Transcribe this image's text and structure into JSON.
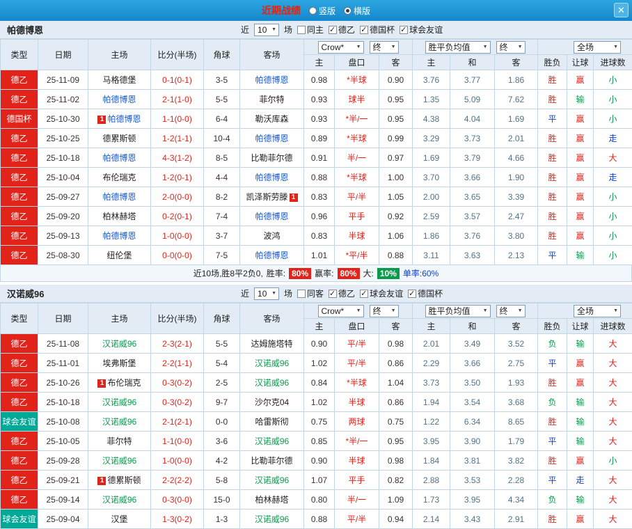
{
  "topbar": {
    "title": "近期战绩",
    "radios": [
      {
        "label": "竖版",
        "selected": false
      },
      {
        "label": "横版",
        "selected": true
      }
    ],
    "close": "✕"
  },
  "result_colors": {
    "胜": "#e2231a",
    "赢": "#e2231a",
    "大": "#e2231a",
    "平": "#1040d0",
    "走": "#1040d0",
    "负": "#089b4c",
    "输": "#089b4c",
    "小": "#089b4c"
  },
  "league_colors": {
    "德乙": "#e2231a",
    "德国杯": "#e2231a",
    "球会友谊": "#00a896"
  },
  "sections": [
    {
      "team": "帕德博恩",
      "highlight": "#1659d0",
      "filters": {
        "near": "近",
        "count": "10",
        "unit": "场",
        "checks": [
          {
            "label": "同主",
            "checked": false
          },
          {
            "label": "德乙",
            "checked": true
          },
          {
            "label": "德国杯",
            "checked": true
          },
          {
            "label": "球会友谊",
            "checked": true
          }
        ]
      },
      "selects": {
        "company": "Crow*",
        "final": "终",
        "average": "胜平负均值",
        "final2": "终",
        "scope": "全场"
      },
      "columns": {
        "type": "类型",
        "date": "日期",
        "home": "主场",
        "score": "比分(半场)",
        "corner": "角球",
        "away": "客场",
        "sub": [
          "主",
          "盘口",
          "客",
          "主",
          "和",
          "客",
          "胜负",
          "让球",
          "进球数"
        ]
      },
      "rows": [
        {
          "league": "德乙",
          "date": "25-11-09",
          "home": {
            "name": "马格德堡"
          },
          "score": "0-1(0-1)",
          "corner": "3-5",
          "away": {
            "name": "帕德博恩",
            "hl": true
          },
          "asia": [
            "0.98",
            "*半球",
            "0.90"
          ],
          "europe": [
            "3.76",
            "3.77",
            "1.86"
          ],
          "res": [
            "胜",
            "赢",
            "小"
          ]
        },
        {
          "league": "德乙",
          "date": "25-11-02",
          "home": {
            "name": "帕德博恩",
            "hl": true
          },
          "score": "2-1(1-0)",
          "corner": "5-5",
          "away": {
            "name": "菲尔特"
          },
          "asia": [
            "0.93",
            "球半",
            "0.95"
          ],
          "europe": [
            "1.35",
            "5.09",
            "7.62"
          ],
          "res": [
            "胜",
            "输",
            "小"
          ]
        },
        {
          "league": "德国杯",
          "date": "25-10-30",
          "home": {
            "name": "帕德博恩",
            "hl": true,
            "badge": "1"
          },
          "score": "1-1(0-0)",
          "corner": "6-4",
          "away": {
            "name": "勒沃库森"
          },
          "asia": [
            "0.93",
            "*半/一",
            "0.95"
          ],
          "europe": [
            "4.38",
            "4.04",
            "1.69"
          ],
          "res": [
            "平",
            "赢",
            "小"
          ]
        },
        {
          "league": "德乙",
          "date": "25-10-25",
          "home": {
            "name": "德累斯顿"
          },
          "score": "1-2(1-1)",
          "corner": "10-4",
          "away": {
            "name": "帕德博恩",
            "hl": true
          },
          "asia": [
            "0.89",
            "*半球",
            "0.99"
          ],
          "europe": [
            "3.29",
            "3.73",
            "2.01"
          ],
          "res": [
            "胜",
            "赢",
            "走"
          ]
        },
        {
          "league": "德乙",
          "date": "25-10-18",
          "home": {
            "name": "帕德博恩",
            "hl": true
          },
          "score": "4-3(1-2)",
          "corner": "8-5",
          "away": {
            "name": "比勒菲尔德"
          },
          "asia": [
            "0.91",
            "半/一",
            "0.97"
          ],
          "europe": [
            "1.69",
            "3.79",
            "4.66"
          ],
          "res": [
            "胜",
            "赢",
            "大"
          ]
        },
        {
          "league": "德乙",
          "date": "25-10-04",
          "home": {
            "name": "布伦瑞克"
          },
          "score": "1-2(0-1)",
          "corner": "4-4",
          "away": {
            "name": "帕德博恩",
            "hl": true
          },
          "asia": [
            "0.88",
            "*半球",
            "1.00"
          ],
          "europe": [
            "3.70",
            "3.66",
            "1.90"
          ],
          "res": [
            "胜",
            "赢",
            "走"
          ]
        },
        {
          "league": "德乙",
          "date": "25-09-27",
          "home": {
            "name": "帕德博恩",
            "hl": true
          },
          "score": "2-0(0-0)",
          "corner": "8-2",
          "away": {
            "name": "凯泽斯劳滕",
            "badge": "1"
          },
          "asia": [
            "0.83",
            "平/半",
            "1.05"
          ],
          "europe": [
            "2.00",
            "3.65",
            "3.39"
          ],
          "res": [
            "胜",
            "赢",
            "小"
          ]
        },
        {
          "league": "德乙",
          "date": "25-09-20",
          "home": {
            "name": "柏林赫塔"
          },
          "score": "0-2(0-1)",
          "corner": "7-4",
          "away": {
            "name": "帕德博恩",
            "hl": true
          },
          "asia": [
            "0.96",
            "平手",
            "0.92"
          ],
          "europe": [
            "2.59",
            "3.57",
            "2.47"
          ],
          "res": [
            "胜",
            "赢",
            "小"
          ]
        },
        {
          "league": "德乙",
          "date": "25-09-13",
          "home": {
            "name": "帕德博恩",
            "hl": true
          },
          "score": "1-0(0-0)",
          "corner": "3-7",
          "away": {
            "name": "波鸿"
          },
          "asia": [
            "0.83",
            "半球",
            "1.06"
          ],
          "europe": [
            "1.86",
            "3.76",
            "3.80"
          ],
          "res": [
            "胜",
            "赢",
            "小"
          ]
        },
        {
          "league": "德乙",
          "date": "25-08-30",
          "home": {
            "name": "纽伦堡"
          },
          "score": "0-0(0-0)",
          "corner": "7-5",
          "away": {
            "name": "帕德博恩",
            "hl": true
          },
          "asia": [
            "1.01",
            "*平/半",
            "0.88"
          ],
          "europe": [
            "3.11",
            "3.63",
            "2.13"
          ],
          "res": [
            "平",
            "输",
            "小"
          ]
        }
      ],
      "footer": {
        "summary": "近10场,胜8平2负0,",
        "win_label": "胜率:",
        "win_value": "80%",
        "hcap_label": "赢率:",
        "hcap_value": "80%",
        "big_label": "大:",
        "big_value": "10%",
        "single": "单率:60%"
      }
    },
    {
      "team": "汉诺威96",
      "highlight": "#089b4c",
      "filters": {
        "near": "近",
        "count": "10",
        "unit": "场",
        "checks": [
          {
            "label": "同客",
            "checked": false
          },
          {
            "label": "德乙",
            "checked": true
          },
          {
            "label": "球会友谊",
            "checked": true
          },
          {
            "label": "德国杯",
            "checked": true
          }
        ]
      },
      "selects": {
        "company": "Crow*",
        "final": "终",
        "average": "胜平负均值",
        "final2": "终",
        "scope": "全场"
      },
      "columns": {
        "type": "类型",
        "date": "日期",
        "home": "主场",
        "score": "比分(半场)",
        "corner": "角球",
        "away": "客场",
        "sub": [
          "主",
          "盘口",
          "客",
          "主",
          "和",
          "客",
          "胜负",
          "让球",
          "进球数"
        ]
      },
      "rows": [
        {
          "league": "德乙",
          "date": "25-11-08",
          "home": {
            "name": "汉诺威96",
            "hl": true
          },
          "score": "2-3(2-1)",
          "corner": "5-5",
          "away": {
            "name": "达姆施塔特"
          },
          "asia": [
            "0.90",
            "平/半",
            "0.98"
          ],
          "europe": [
            "2.01",
            "3.49",
            "3.52"
          ],
          "res": [
            "负",
            "输",
            "大"
          ]
        },
        {
          "league": "德乙",
          "date": "25-11-01",
          "home": {
            "name": "埃弗斯堡"
          },
          "score": "2-2(1-1)",
          "corner": "5-4",
          "away": {
            "name": "汉诺威96",
            "hl": true
          },
          "asia": [
            "1.02",
            "平/半",
            "0.86"
          ],
          "europe": [
            "2.29",
            "3.66",
            "2.75"
          ],
          "res": [
            "平",
            "赢",
            "大"
          ]
        },
        {
          "league": "德乙",
          "date": "25-10-26",
          "home": {
            "name": "布伦瑞克",
            "badge": "1"
          },
          "score": "0-3(0-2)",
          "corner": "2-5",
          "away": {
            "name": "汉诺威96",
            "hl": true
          },
          "asia": [
            "0.84",
            "*半球",
            "1.04"
          ],
          "europe": [
            "3.73",
            "3.50",
            "1.93"
          ],
          "res": [
            "胜",
            "赢",
            "大"
          ]
        },
        {
          "league": "德乙",
          "date": "25-10-18",
          "home": {
            "name": "汉诺威96",
            "hl": true
          },
          "score": "0-3(0-2)",
          "corner": "9-7",
          "away": {
            "name": "沙尔克04"
          },
          "asia": [
            "1.02",
            "半球",
            "0.86"
          ],
          "europe": [
            "1.94",
            "3.54",
            "3.68"
          ],
          "res": [
            "负",
            "输",
            "大"
          ]
        },
        {
          "league": "球会友谊",
          "date": "25-10-08",
          "home": {
            "name": "汉诺威96",
            "hl": true
          },
          "score": "2-1(2-1)",
          "corner": "0-0",
          "away": {
            "name": "哈雷斯彻"
          },
          "asia": [
            "0.75",
            "两球",
            "0.75"
          ],
          "europe": [
            "1.22",
            "6.34",
            "8.65"
          ],
          "res": [
            "胜",
            "输",
            "大"
          ]
        },
        {
          "league": "德乙",
          "date": "25-10-05",
          "home": {
            "name": "菲尔特"
          },
          "score": "1-1(0-0)",
          "corner": "3-6",
          "away": {
            "name": "汉诺威96",
            "hl": true
          },
          "asia": [
            "0.85",
            "*半/一",
            "0.95"
          ],
          "europe": [
            "3.95",
            "3.90",
            "1.79"
          ],
          "res": [
            "平",
            "输",
            "大"
          ]
        },
        {
          "league": "德乙",
          "date": "25-09-28",
          "home": {
            "name": "汉诺威96",
            "hl": true
          },
          "score": "1-0(0-0)",
          "corner": "4-2",
          "away": {
            "name": "比勒菲尔德"
          },
          "asia": [
            "0.90",
            "半球",
            "0.98"
          ],
          "europe": [
            "1.84",
            "3.81",
            "3.82"
          ],
          "res": [
            "胜",
            "赢",
            "小"
          ]
        },
        {
          "league": "德乙",
          "date": "25-09-21",
          "home": {
            "name": "德累斯顿",
            "badge": "1"
          },
          "score": "2-2(2-2)",
          "corner": "5-8",
          "away": {
            "name": "汉诺威96",
            "hl": true
          },
          "asia": [
            "1.07",
            "平手",
            "0.82"
          ],
          "europe": [
            "2.88",
            "3.53",
            "2.28"
          ],
          "res": [
            "平",
            "走",
            "大"
          ]
        },
        {
          "league": "德乙",
          "date": "25-09-14",
          "home": {
            "name": "汉诺威96",
            "hl": true
          },
          "score": "0-3(0-0)",
          "corner": "15-0",
          "away": {
            "name": "柏林赫塔"
          },
          "asia": [
            "0.80",
            "半/一",
            "1.09"
          ],
          "europe": [
            "1.73",
            "3.95",
            "4.34"
          ],
          "res": [
            "负",
            "输",
            "大"
          ]
        },
        {
          "league": "球会友谊",
          "date": "25-09-04",
          "home": {
            "name": "汉堡"
          },
          "score": "1-3(0-2)",
          "corner": "1-3",
          "away": {
            "name": "汉诺威96",
            "hl": true
          },
          "asia": [
            "0.88",
            "平/半",
            "0.94"
          ],
          "europe": [
            "2.14",
            "3.43",
            "2.91"
          ],
          "res": [
            "胜",
            "赢",
            "大"
          ]
        }
      ]
    }
  ]
}
